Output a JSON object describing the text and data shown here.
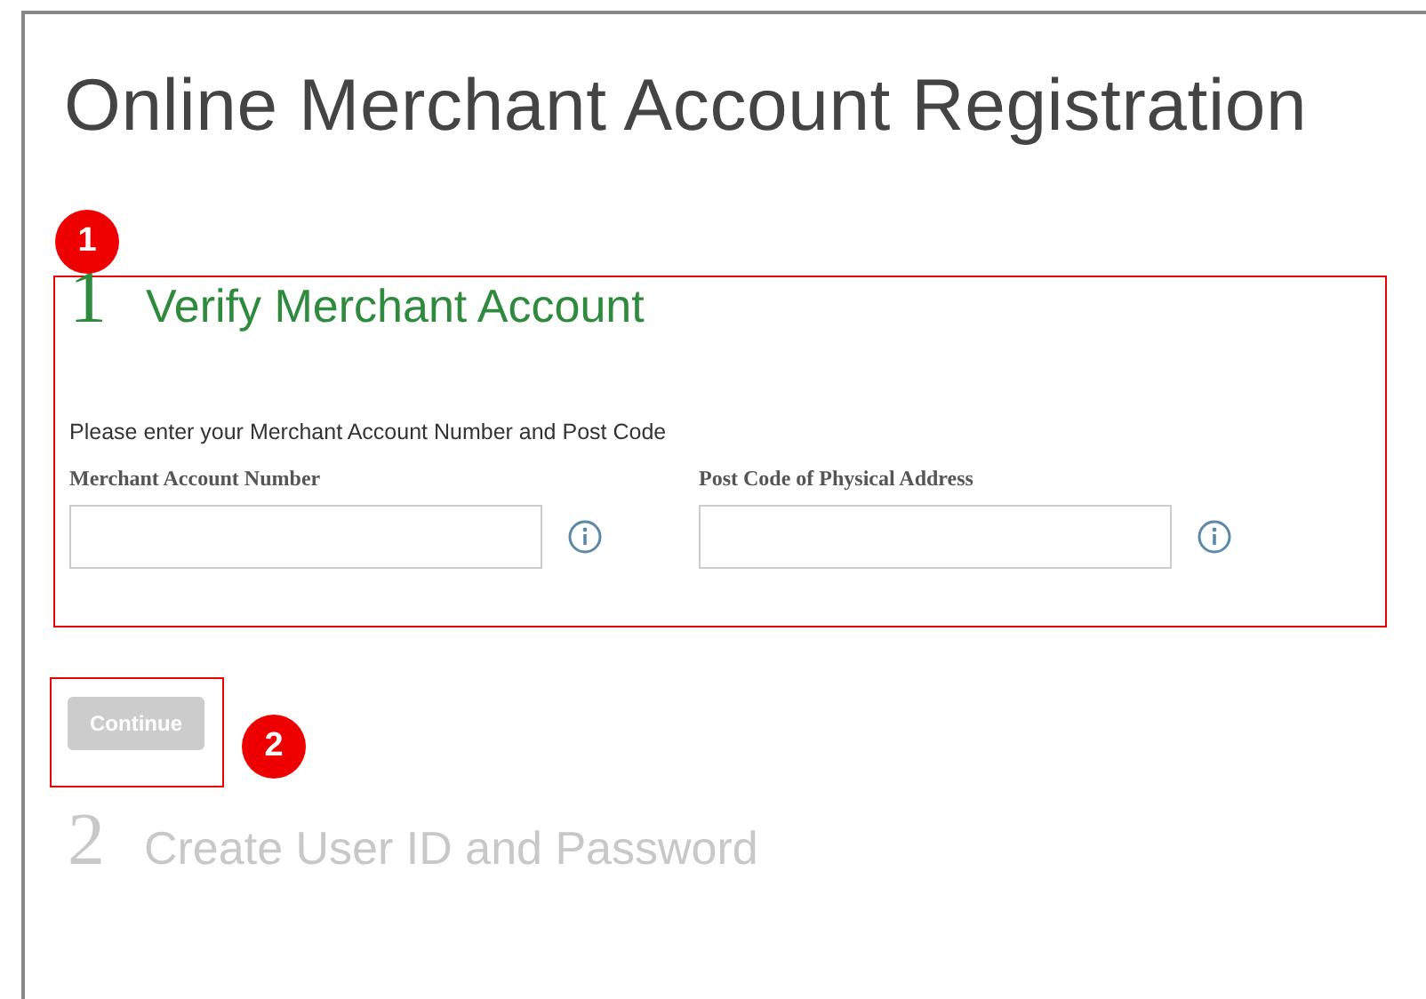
{
  "title": "Online Merchant Account Registration",
  "steps": [
    {
      "number": "1",
      "title": "Verify Merchant Account",
      "active": true,
      "annotation": "1",
      "instructions": "Please enter your Merchant Account Number and Post Code",
      "fields": [
        {
          "label": "Merchant Account Number"
        },
        {
          "label": "Post Code of Physical Address"
        }
      ],
      "button": {
        "label": "Continue",
        "disabled": true,
        "annotation": "2"
      }
    },
    {
      "number": "2",
      "title": "Create User ID and Password",
      "active": false
    }
  ]
}
